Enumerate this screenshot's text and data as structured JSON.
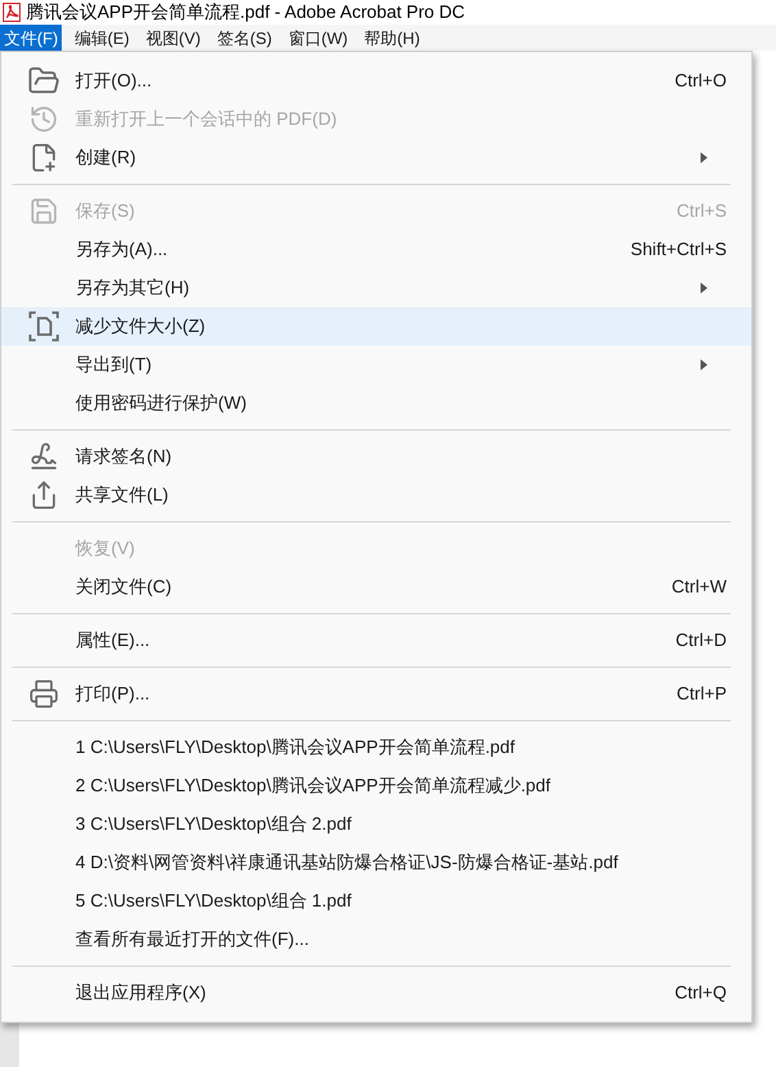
{
  "window": {
    "title": "腾讯会议APP开会简单流程.pdf - Adobe Acrobat Pro DC"
  },
  "menu_bar": [
    {
      "label": "文件(F)",
      "selected": true
    },
    {
      "label": "编辑(E)",
      "selected": false
    },
    {
      "label": "视图(V)",
      "selected": false
    },
    {
      "label": "签名(S)",
      "selected": false
    },
    {
      "label": "窗口(W)",
      "selected": false
    },
    {
      "label": "帮助(H)",
      "selected": false
    }
  ],
  "file_menu": {
    "groups": [
      [
        {
          "label": "打开(O)...",
          "shortcut": "Ctrl+O",
          "submenu": false,
          "disabled": false,
          "selected": false
        },
        {
          "label": "重新打开上一个会话中的 PDF(D)",
          "submenu": false,
          "disabled": true,
          "selected": false
        },
        {
          "label": "创建(R)",
          "submenu": true,
          "disabled": false,
          "selected": false
        }
      ],
      [
        {
          "label": "保存(S)",
          "shortcut": "Ctrl+S",
          "submenu": false,
          "disabled": true,
          "selected": false
        },
        {
          "label": "另存为(A)...",
          "shortcut": "Shift+Ctrl+S",
          "submenu": false,
          "disabled": false,
          "selected": false
        },
        {
          "label": "另存为其它(H)",
          "submenu": true,
          "disabled": false,
          "selected": false
        },
        {
          "label": "减少文件大小(Z)",
          "submenu": false,
          "disabled": false,
          "selected": true
        },
        {
          "label": "导出到(T)",
          "submenu": true,
          "disabled": false,
          "selected": false
        },
        {
          "label": "使用密码进行保护(W)",
          "submenu": false,
          "disabled": false,
          "selected": false
        }
      ],
      [
        {
          "label": "请求签名(N)",
          "submenu": false,
          "disabled": false,
          "selected": false
        },
        {
          "label": "共享文件(L)",
          "submenu": false,
          "disabled": false,
          "selected": false
        }
      ],
      [
        {
          "label": "恢复(V)",
          "submenu": false,
          "disabled": true,
          "selected": false
        },
        {
          "label": "关闭文件(C)",
          "shortcut": "Ctrl+W",
          "submenu": false,
          "disabled": false,
          "selected": false
        }
      ],
      [
        {
          "label": "属性(E)...",
          "shortcut": "Ctrl+D",
          "submenu": false,
          "disabled": false,
          "selected": false
        }
      ],
      [
        {
          "label": "打印(P)...",
          "shortcut": "Ctrl+P",
          "submenu": false,
          "disabled": false,
          "selected": false
        }
      ],
      [
        {
          "label": "1 C:\\Users\\FLY\\Desktop\\腾讯会议APP开会简单流程.pdf",
          "submenu": false,
          "disabled": false,
          "selected": false
        },
        {
          "label": "2 C:\\Users\\FLY\\Desktop\\腾讯会议APP开会简单流程减少.pdf",
          "submenu": false,
          "disabled": false,
          "selected": false
        },
        {
          "label": "3 C:\\Users\\FLY\\Desktop\\组合 2.pdf",
          "submenu": false,
          "disabled": false,
          "selected": false
        },
        {
          "label": "4 D:\\资料\\网管资料\\祥康通讯基站防爆合格证\\JS-防爆合格证-基站.pdf",
          "submenu": false,
          "disabled": false,
          "selected": false
        },
        {
          "label": "5 C:\\Users\\FLY\\Desktop\\组合 1.pdf",
          "submenu": false,
          "disabled": false,
          "selected": false
        },
        {
          "label": "查看所有最近打开的文件(F)...",
          "submenu": false,
          "disabled": false,
          "selected": false
        }
      ],
      [
        {
          "label": "退出应用程序(X)",
          "shortcut": "Ctrl+Q",
          "submenu": false,
          "disabled": false,
          "selected": false
        }
      ]
    ]
  }
}
